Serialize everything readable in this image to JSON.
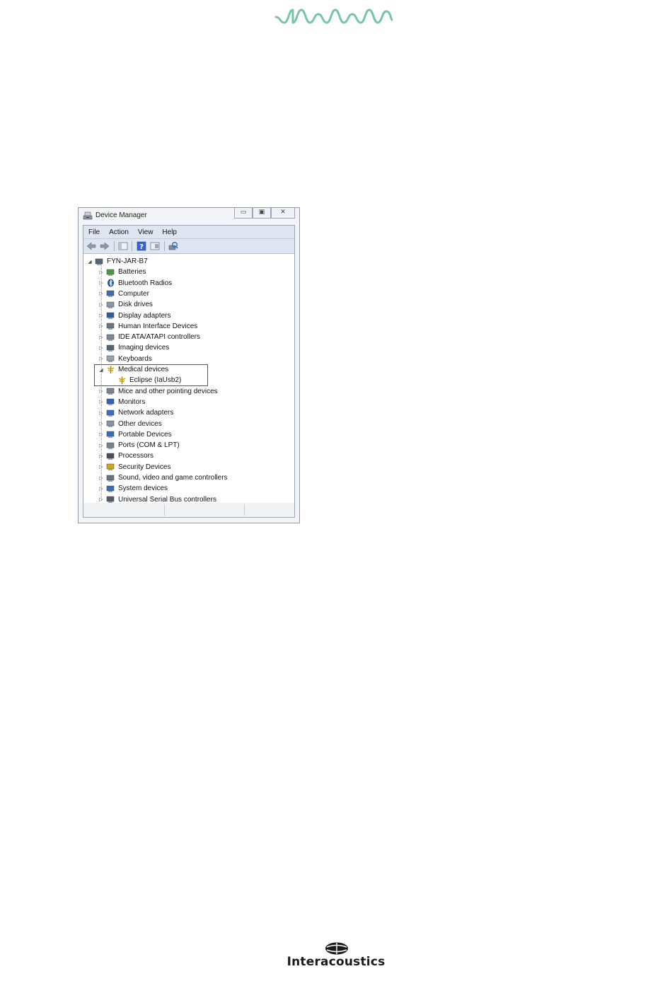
{
  "brand": {
    "name": "Interacoustics",
    "accent_color": "#78c4a6"
  },
  "window": {
    "title": "Device Manager",
    "controls": [
      "minimize",
      "maximize",
      "close"
    ]
  },
  "menu": [
    "File",
    "Action",
    "View",
    "Help"
  ],
  "toolbar": [
    "back-icon",
    "forward-icon",
    "show-hide-console-tree-icon",
    "help-icon",
    "properties-icon",
    "scan-hardware-icon"
  ],
  "tree": {
    "root": "FYN-JAR-B7",
    "items": [
      {
        "label": "Batteries",
        "icon": "battery-icon",
        "expanded": false
      },
      {
        "label": "Bluetooth Radios",
        "icon": "bluetooth-icon",
        "expanded": false
      },
      {
        "label": "Computer",
        "icon": "computer-icon",
        "expanded": false
      },
      {
        "label": "Disk drives",
        "icon": "disk-drive-icon",
        "expanded": false
      },
      {
        "label": "Display adapters",
        "icon": "display-adapter-icon",
        "expanded": false
      },
      {
        "label": "Human Interface Devices",
        "icon": "hid-icon",
        "expanded": false
      },
      {
        "label": "IDE ATA/ATAPI controllers",
        "icon": "ide-controller-icon",
        "expanded": false
      },
      {
        "label": "Imaging devices",
        "icon": "imaging-device-icon",
        "expanded": false
      },
      {
        "label": "Keyboards",
        "icon": "keyboard-icon",
        "expanded": false
      },
      {
        "label": "Medical devices",
        "icon": "medical-device-icon",
        "expanded": true,
        "children": [
          "Eclipse (IaUsb2)"
        ]
      },
      {
        "label": "Mice and other pointing devices",
        "icon": "mouse-icon",
        "expanded": false
      },
      {
        "label": "Monitors",
        "icon": "monitor-icon",
        "expanded": false
      },
      {
        "label": "Network adapters",
        "icon": "network-adapter-icon",
        "expanded": false
      },
      {
        "label": "Other devices",
        "icon": "other-device-icon",
        "expanded": false
      },
      {
        "label": "Portable Devices",
        "icon": "portable-device-icon",
        "expanded": false
      },
      {
        "label": "Ports (COM & LPT)",
        "icon": "port-icon",
        "expanded": false
      },
      {
        "label": "Processors",
        "icon": "processor-icon",
        "expanded": false
      },
      {
        "label": "Security Devices",
        "icon": "security-device-icon",
        "expanded": false
      },
      {
        "label": "Sound, video and game controllers",
        "icon": "sound-icon",
        "expanded": false
      },
      {
        "label": "System devices",
        "icon": "system-device-icon",
        "expanded": false
      },
      {
        "label": "Universal Serial Bus controllers",
        "icon": "usb-icon",
        "expanded": false
      }
    ]
  },
  "highlight_color": "#c0272d"
}
